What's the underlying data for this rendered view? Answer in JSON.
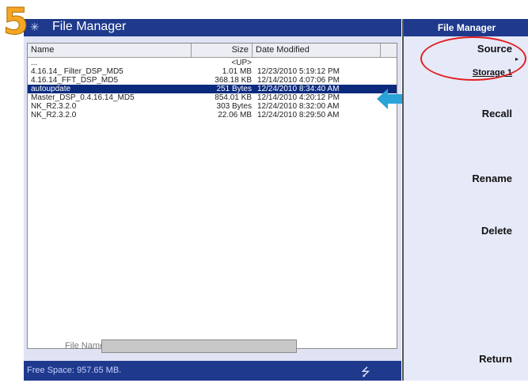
{
  "badge": "5",
  "window": {
    "title": "File Manager",
    "columns": {
      "name": "Name",
      "size": "Size",
      "date": "Date Modified"
    },
    "rows": [
      {
        "name": "...",
        "size": "<UP>",
        "date": "",
        "selected": false
      },
      {
        "name": "4.16.14_ Filter_DSP_MD5",
        "size": "1.01 MB",
        "date": "12/23/2010 5:19:12 PM",
        "selected": false
      },
      {
        "name": "4.16.14_FFT_DSP_MD5",
        "size": "368.18 KB",
        "date": "12/14/2010 4:07:06 PM",
        "selected": false
      },
      {
        "name": "autoupdate",
        "size": "251 Bytes",
        "date": "12/24/2010 8:34:40 AM",
        "selected": true
      },
      {
        "name": "Master_DSP_0.4.16.14_MD5",
        "size": "854.01 KB",
        "date": "12/14/2010 4:20:12 PM",
        "selected": false
      },
      {
        "name": "NK_R2.3.2.0",
        "size": "303 Bytes",
        "date": "12/24/2010 8:32:00 AM",
        "selected": false
      },
      {
        "name": "NK_R2.3.2.0",
        "size": "22.06 MB",
        "date": "12/24/2010 8:29:50 AM",
        "selected": false
      }
    ],
    "filename_label": "File Name:",
    "filename_value": "",
    "free_space": "Free Space: 957.65 MB."
  },
  "panel": {
    "title": "File Manager",
    "source_label": "Source",
    "source_value": "Storage 1",
    "recall_label": "Recall",
    "rename_label": "Rename",
    "delete_label": "Delete",
    "return_label": "Return"
  },
  "colors": {
    "titlebar": "#1f3a8c",
    "selection": "#0c2a7d",
    "annotation_ellipse": "#e02020",
    "annotation_arrow": "#2aa3d8",
    "badge": "#f5a623"
  },
  "icons": {
    "settings": "gear-icon",
    "usb": "usb-icon",
    "arrow": "pointer-arrow-icon"
  }
}
